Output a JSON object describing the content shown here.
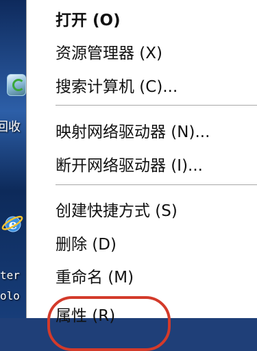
{
  "desktop": {
    "recycle_label": "回收",
    "ie_label_1": "ter",
    "ie_label_2": "olo"
  },
  "menu": {
    "items": [
      {
        "label": "打开 (O)"
      },
      {
        "label": "资源管理器 (X)"
      },
      {
        "label": "搜索计算机 (C)..."
      },
      {
        "label": "映射网络驱动器 (N)..."
      },
      {
        "label": "断开网络驱动器 (I)..."
      },
      {
        "label": "创建快捷方式 (S)"
      },
      {
        "label": "删除 (D)"
      },
      {
        "label": "重命名 (M)"
      },
      {
        "label": "属性 (R)"
      }
    ]
  },
  "colors": {
    "highlight": "#d33a2a"
  }
}
